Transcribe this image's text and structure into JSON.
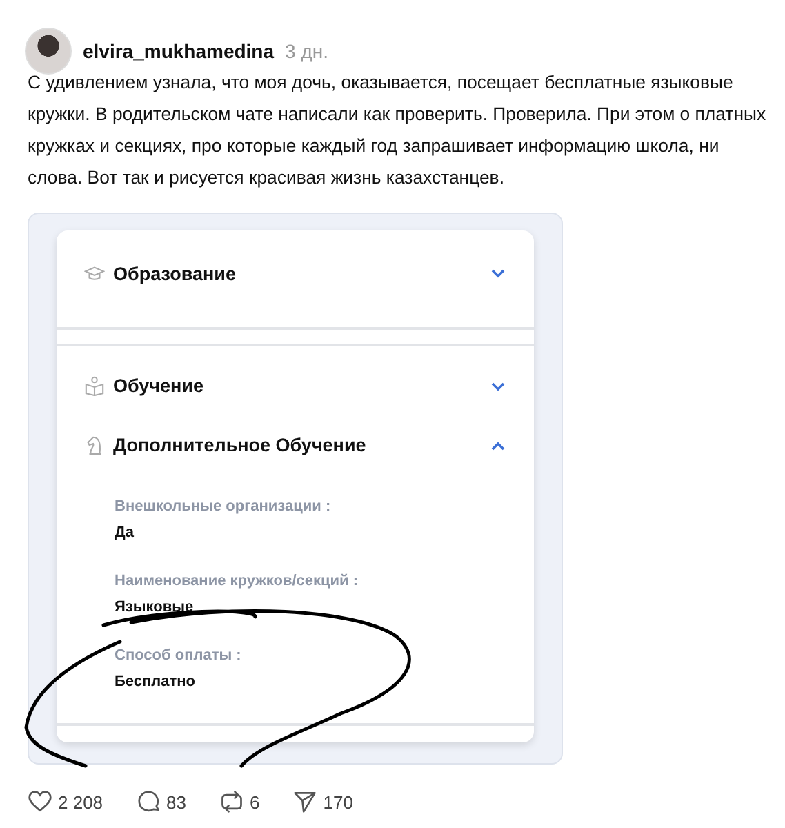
{
  "post": {
    "author": "elvira_mukhamedina",
    "time": "3 дн.",
    "text": "С удивлением узнала, что моя дочь, оказывается, посещает бесплатные языковые кружки. В родительском чате написали как проверить. Проверила. При этом о платных кружках и секциях, про которые каждый год запрашивает информацию школа, ни слова. Вот так и рисуется красивая жизнь казахстанцев."
  },
  "screenshot": {
    "sections": [
      {
        "kind": "education",
        "title": "Образование",
        "expanded": false
      },
      {
        "kind": "learning",
        "title": "Обучение",
        "expanded": false
      },
      {
        "kind": "extra",
        "title": "Дополнительное Обучение",
        "expanded": true,
        "fields": [
          {
            "label": "Внешкольные организации :",
            "value": "Да"
          },
          {
            "label": "Наименование кружков/секций :",
            "value": "Языковые"
          },
          {
            "label": "Способ оплаты :",
            "value": "Бесплатно"
          }
        ]
      }
    ]
  },
  "actions": [
    {
      "kind": "like",
      "count": "2 208"
    },
    {
      "kind": "reply",
      "count": "83"
    },
    {
      "kind": "repost",
      "count": "6"
    },
    {
      "kind": "share",
      "count": "170"
    }
  ]
}
